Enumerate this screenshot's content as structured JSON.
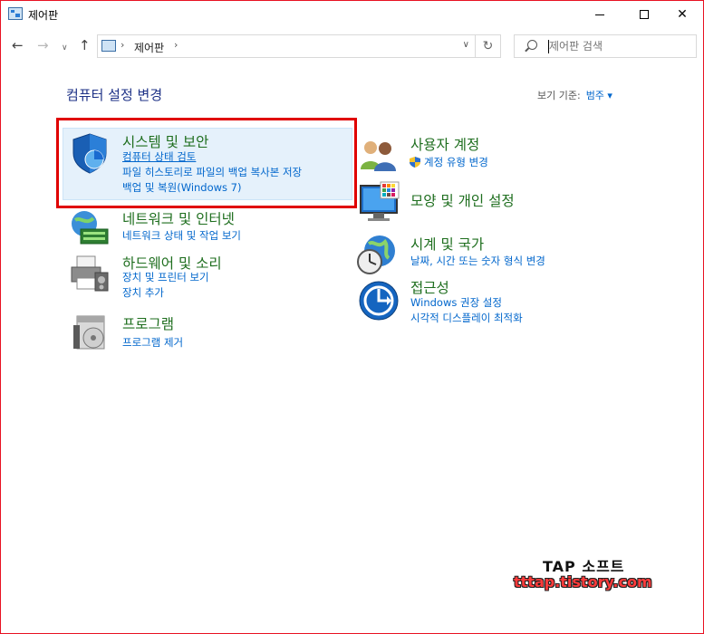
{
  "window": {
    "title": "제어판",
    "min_glyph": "",
    "max_glyph": "",
    "close_glyph": "✕",
    "border_color": "#e81123"
  },
  "nav": {
    "back_glyph": "←",
    "forward_glyph": "→",
    "recent_glyph": "∨",
    "up_glyph": "↑",
    "breadcrumb_sep": "›",
    "breadcrumb": "제어판",
    "dropdown_glyph": "∨",
    "refresh_glyph": "↻",
    "search_placeholder": "제어판 검색"
  },
  "main": {
    "heading": "컴퓨터 설정 변경",
    "view_by_label": "보기 기준:",
    "view_by_value": "범주 ▾"
  },
  "categories": {
    "system": {
      "title": "시스템 및 보안",
      "links": [
        "컴퓨터 상태 검토",
        "파일 히스토리로 파일의 백업 복사본 저장",
        "백업 및 복원(Windows 7)"
      ]
    },
    "network": {
      "title": "네트워크 및 인터넷",
      "links": [
        "네트워크 상태 및 작업 보기"
      ]
    },
    "hardware": {
      "title": "하드웨어 및 소리",
      "links": [
        "장치 및 프린터 보기",
        "장치 추가"
      ]
    },
    "programs": {
      "title": "프로그램",
      "links": [
        "프로그램 제거"
      ]
    },
    "accounts": {
      "title": "사용자 계정",
      "links": [
        "계정 유형 변경"
      ]
    },
    "appearance": {
      "title": "모양 및 개인 설정",
      "links": []
    },
    "clock": {
      "title": "시계 및 국가",
      "links": [
        "날짜, 시간 또는 숫자 형식 변경"
      ]
    },
    "access": {
      "title": "접근성",
      "links": [
        "Windows 권장 설정",
        "시각적 디스플레이 최적화"
      ]
    }
  },
  "watermark": {
    "line1": "TAP 소프트",
    "line2": "tttap.tistory.com"
  },
  "colors": {
    "category_title": "#1e6e1e",
    "link": "#0066cc",
    "heading": "#1e3287",
    "highlight_bg": "#e5f1fb",
    "red_box": "#e00000"
  }
}
